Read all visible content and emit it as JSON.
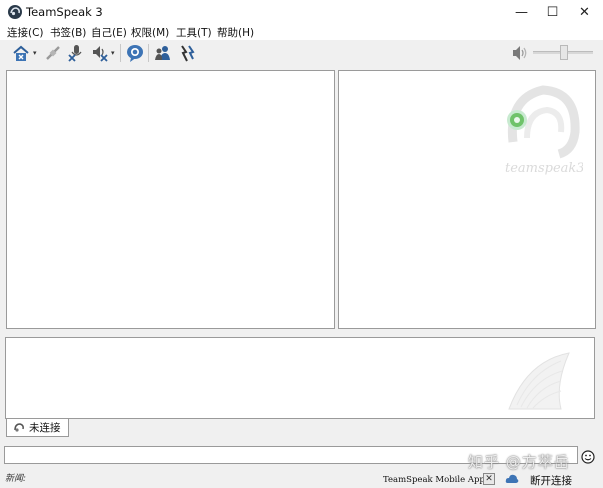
{
  "window": {
    "title": "TeamSpeak 3",
    "minimize_glyph": "—",
    "maximize_glyph": "☐",
    "close_glyph": "✕"
  },
  "menu": {
    "items": [
      "连接(C)",
      "书签(B)",
      "自己(E)",
      "权限(M)",
      "工具(T)",
      "帮助(H)"
    ]
  },
  "toolbar": {
    "icons": [
      "connect-icon",
      "disconnect-icon",
      "mute-microphone-icon",
      "mute-speakers-icon",
      "away-icon",
      "contacts-icon",
      "whisper-icon"
    ],
    "dropdown_glyph": "▾"
  },
  "main": {
    "tab_label": "未连接",
    "chat_input": {
      "value": "",
      "placeholder": ""
    }
  },
  "status": {
    "news_label": "新闻:",
    "mobile_app_text": "TeamSpeak Mobile Apps",
    "mobile_close_glyph": "✕",
    "connection_status": "断开连接"
  },
  "overlay": {
    "watermark_credit": "知乎 @方萃岳"
  },
  "colors": {
    "panel_border": "#9a9a9a",
    "panel_bg": "#ffffff",
    "chrome_bg": "#f0f0f0",
    "logo_green": "#6fc36a"
  }
}
